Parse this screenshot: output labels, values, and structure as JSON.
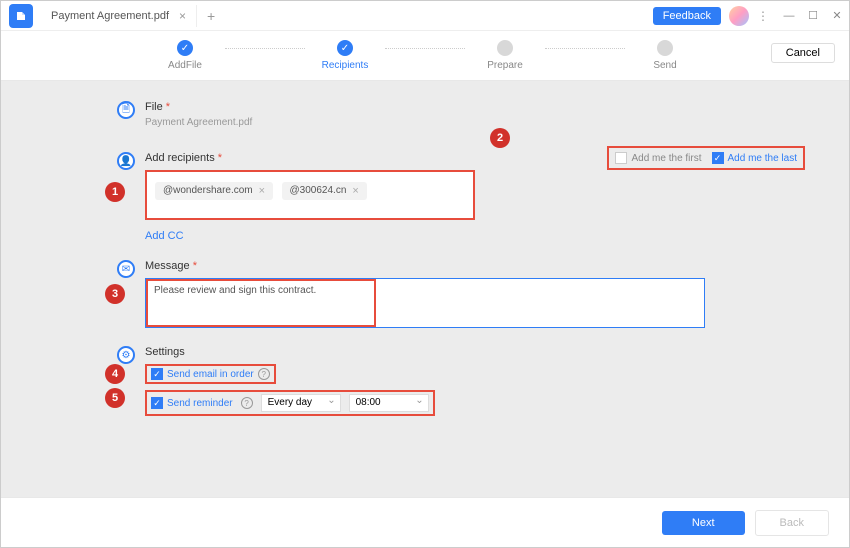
{
  "titlebar": {
    "tab_title": "Payment Agreement.pdf",
    "feedback": "Feedback"
  },
  "stepper": {
    "steps": [
      "AddFile",
      "Recipients",
      "Prepare",
      "Send"
    ],
    "cancel": "Cancel"
  },
  "file": {
    "label": "File",
    "name": "Payment Agreement.pdf"
  },
  "recipients": {
    "label": "Add recipients",
    "chips": [
      "@wondershare.com",
      "@300624.cn"
    ],
    "add_cc": "Add CC",
    "add_first": "Add me the first",
    "add_last": "Add me the last"
  },
  "message": {
    "label": "Message",
    "text": "Please review and sign this contract."
  },
  "settings": {
    "label": "Settings",
    "send_order": "Send email in order",
    "send_reminder": "Send reminder",
    "frequency": "Every day",
    "time": "08:00"
  },
  "footer": {
    "next": "Next",
    "back": "Back"
  },
  "badges": [
    "1",
    "2",
    "3",
    "4",
    "5"
  ]
}
